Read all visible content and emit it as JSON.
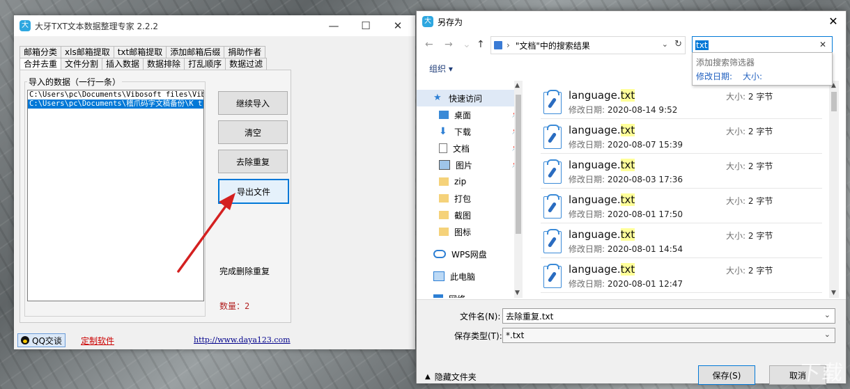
{
  "app": {
    "title": "大牙TXT文本数据整理专家 2.2.2",
    "logo": "大",
    "window_controls": [
      "—",
      "☐",
      "✕"
    ],
    "tabs_row1": [
      "邮箱分类",
      "xls邮箱提取",
      "txt邮箱提取",
      "添加邮箱后缀",
      "捐助作者"
    ],
    "tabs_row2": [
      "合并去重",
      "文件分割",
      "插入数据",
      "数据排除",
      "打乱顺序",
      "数据过滤"
    ],
    "active_tab": "合并去重",
    "group_label": "导入的数据（一行一条）",
    "list_items": [
      "C:\\Users\\pc\\Documents\\Vibosoft files\\Vibos",
      "C:\\Users\\pc\\Documents\\稽爪码字文稿备份\\K t"
    ],
    "buttons": {
      "continue_import": "继续导入",
      "clear": "清空",
      "dedupe": "去除重复",
      "export": "导出文件"
    },
    "status": "完成删除重复",
    "count": "数量：2",
    "qq_label": "QQ交谈",
    "custom_label": "定制软件",
    "url": "http://www.daya123.com"
  },
  "dialog": {
    "title": "另存为",
    "logo": "大",
    "close": "✕",
    "nav": {
      "back": "←",
      "forward": "→",
      "up": "↑",
      "breadcrumb_sep": "›",
      "refresh": "↻",
      "drop": "⌄"
    },
    "address": "\"文档\"中的搜索结果",
    "search_value": "txt",
    "search_clear": "✕",
    "suggest_hint": "添加搜索筛选器",
    "suggest_modified": "修改日期:",
    "suggest_size": "大小:",
    "organize": "组织 ▾",
    "sidebar": [
      {
        "label": "快速访问",
        "icon": "star-icon",
        "pinned": false
      },
      {
        "label": "桌面",
        "icon": "desktop-icon",
        "pinned": true
      },
      {
        "label": "下载",
        "icon": "download-icon",
        "pinned": true
      },
      {
        "label": "文档",
        "icon": "document-icon",
        "pinned": true
      },
      {
        "label": "图片",
        "icon": "pictures-icon",
        "pinned": true
      },
      {
        "label": "zip",
        "icon": "folder-icon",
        "pinned": false
      },
      {
        "label": "打包",
        "icon": "folder-icon",
        "pinned": false
      },
      {
        "label": "截图",
        "icon": "folder-icon",
        "pinned": false
      },
      {
        "label": "图标",
        "icon": "folder-icon",
        "pinned": false
      },
      {
        "label": "WPS网盘",
        "icon": "cloud-icon",
        "pinned": false
      },
      {
        "label": "此电脑",
        "icon": "computer-icon",
        "pinned": false
      },
      {
        "label": "网络",
        "icon": "network-icon",
        "pinned": false
      }
    ],
    "files": [
      {
        "name": "language.",
        "ext": "txt",
        "date": "2020-08-14 9:52",
        "size": "2 字节"
      },
      {
        "name": "language.",
        "ext": "txt",
        "date": "2020-08-07 15:39",
        "size": "2 字节"
      },
      {
        "name": "language.",
        "ext": "txt",
        "date": "2020-08-03 17:36",
        "size": "2 字节"
      },
      {
        "name": "language.",
        "ext": "txt",
        "date": "2020-08-01 17:50",
        "size": "2 字节"
      },
      {
        "name": "language.",
        "ext": "txt",
        "date": "2020-08-01 14:54",
        "size": "2 字节"
      },
      {
        "name": "language.",
        "ext": "txt",
        "date": "2020-08-01 12:47",
        "size": "2 字节"
      }
    ],
    "file_date_label": "修改日期:",
    "file_size_label": "大小:",
    "filename_label": "文件名(N):",
    "filename_value": "去除重复.txt",
    "filetype_label": "保存类型(T):",
    "filetype_value": "*.txt",
    "hide_folders": "隐藏文件夹",
    "save": "保存(S)",
    "cancel": "取消"
  },
  "colors": {
    "accent": "#0078d7",
    "highlight": "#ffff99",
    "arrow": "#d42020",
    "count": "#b22222"
  }
}
